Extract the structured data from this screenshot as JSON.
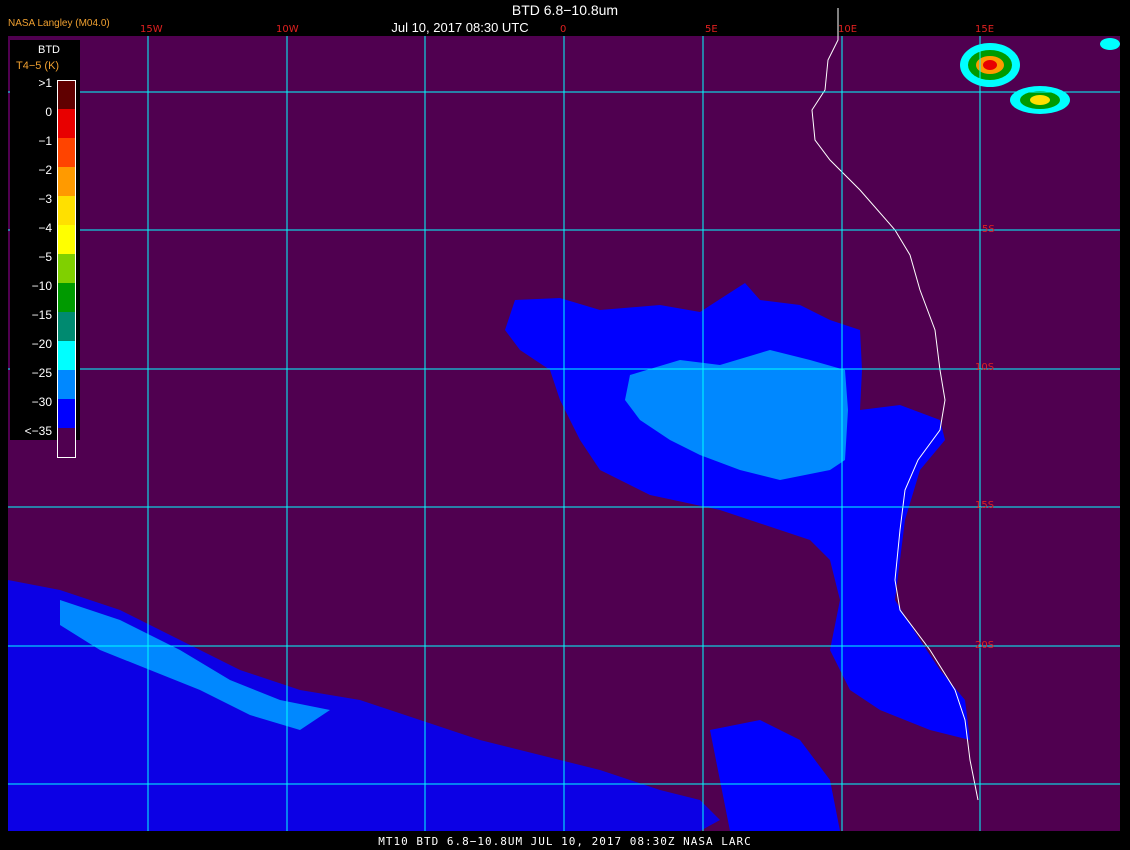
{
  "header": {
    "title": "BTD 6.8−10.8um",
    "subtitle": "Jul 10, 2017 08:30 UTC",
    "org": "NASA Langley (M04.0)"
  },
  "legend": {
    "title": "BTD",
    "subtitle": "T4−5 (K)",
    "entries": [
      {
        "label": ">1",
        "color": "#600000"
      },
      {
        "label": "0",
        "color": "#e80000"
      },
      {
        "label": "−1",
        "color": "#ff4400"
      },
      {
        "label": "−2",
        "color": "#ff9a00"
      },
      {
        "label": "−3",
        "color": "#ffe000"
      },
      {
        "label": "−4",
        "color": "#ffff00"
      },
      {
        "label": "−5",
        "color": "#80d000"
      },
      {
        "label": "−10",
        "color": "#009a00"
      },
      {
        "label": "−15",
        "color": "#008a70"
      },
      {
        "label": "−20",
        "color": "#00ffff"
      },
      {
        "label": "−25",
        "color": "#0088ff"
      },
      {
        "label": "−30",
        "color": "#0000ff"
      },
      {
        "label": "<−35",
        "color": "#500050"
      }
    ]
  },
  "grid": {
    "lon_labels": [
      "15W",
      "10W",
      "0",
      "5E",
      "10E",
      "15E"
    ],
    "lat_labels": [
      "5S",
      "10S",
      "15S",
      "20S"
    ]
  },
  "colors": {
    "background": "#500050",
    "gridline": "#00ffff",
    "coast": "#ffffff"
  },
  "footer": "MT10  BTD 6.8−10.8UM   JUL 10, 2017 08:30Z   NASA LARC"
}
